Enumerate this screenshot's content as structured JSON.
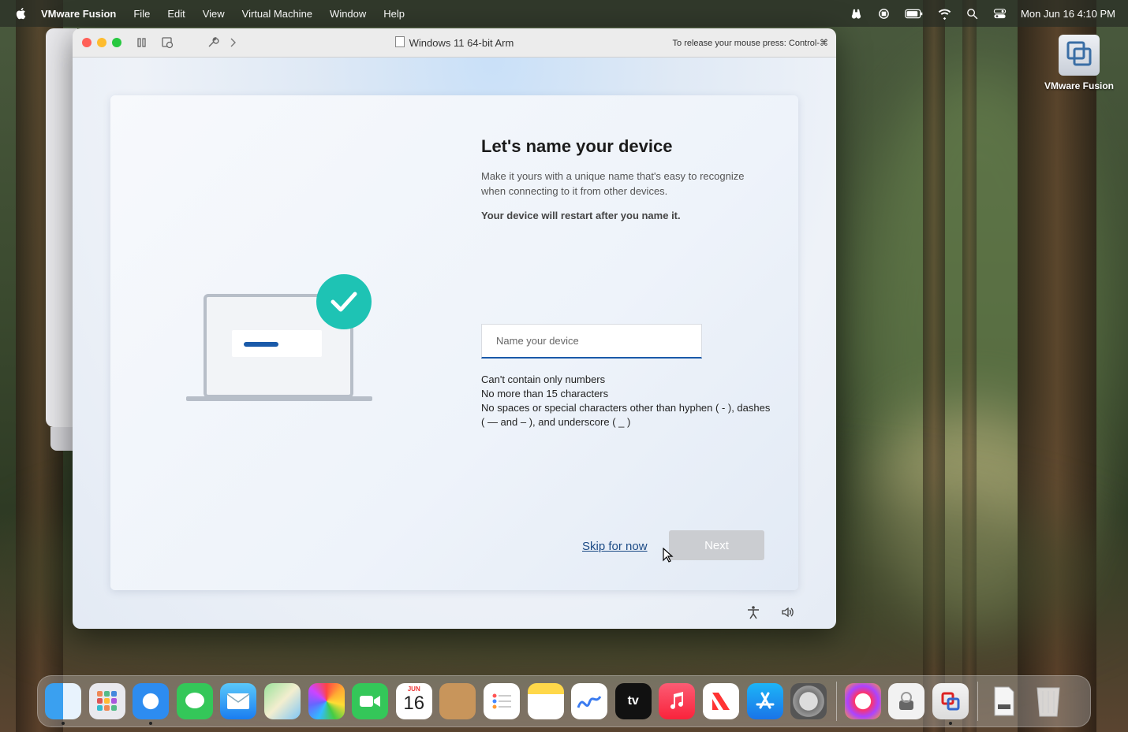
{
  "menubar": {
    "app_name": "VMware Fusion",
    "menus": [
      "File",
      "Edit",
      "View",
      "Virtual Machine",
      "Window",
      "Help"
    ],
    "clock": "Mon Jun 16  4:10 PM"
  },
  "window": {
    "title": "Windows 11 64-bit Arm",
    "release_hint": "To release your mouse press: Control-⌘"
  },
  "oobe": {
    "heading": "Let's name your device",
    "description": "Make it yours with a unique name that's easy to recognize when connecting to it from other devices.",
    "restart_note": "Your device will restart after you name it.",
    "device_name": {
      "value": "",
      "placeholder": "Name your device"
    },
    "rules": [
      "Can't contain only numbers",
      "No more than 15 characters",
      "No spaces or special characters other than hyphen ( - ), dashes ( — and – ), and underscore ( _ )"
    ],
    "skip_label": "Skip for now",
    "next_label": "Next"
  },
  "desktop_icon": {
    "label": "VMware Fusion"
  },
  "dock": {
    "calendar_month": "JUN",
    "calendar_day": "16",
    "apps": [
      "finder-icon",
      "launchpad-icon",
      "safari-icon",
      "messages-icon",
      "mail-icon",
      "maps-icon",
      "photos-icon",
      "facetime-icon",
      "calendar-icon",
      "contacts-icon",
      "reminders-icon",
      "notes-icon",
      "freeform-icon",
      "appletv-icon",
      "music-icon",
      "news-icon",
      "appstore-icon",
      "settings-icon",
      "creative-cloud-icon",
      "automator-icon",
      "vmware-fusion-icon",
      "document-icon",
      "trash-icon"
    ]
  },
  "colors": {
    "accent": "#1a5aa9",
    "check": "#1ec3b4",
    "next_disabled": "#cbcdd1"
  }
}
